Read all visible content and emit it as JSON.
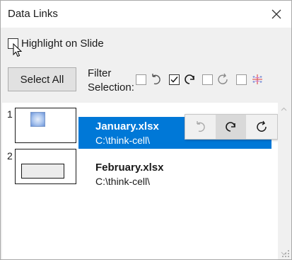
{
  "window": {
    "title": "Data Links"
  },
  "options": {
    "highlight_label": "Highlight on Slide",
    "highlight_checked": false
  },
  "toolbar": {
    "select_all_label": "Select All",
    "filter_label_line1": "Filter",
    "filter_label_line2": "Selection:"
  },
  "filters": [
    {
      "icon": "update-manual-icon",
      "checked": false
    },
    {
      "icon": "update-incoming-icon",
      "checked": true
    },
    {
      "icon": "update-auto-icon",
      "checked": false
    },
    {
      "icon": "tableau-link-icon",
      "checked": false
    }
  ],
  "rows": [
    {
      "number": "1",
      "file_name": "January.xlsx",
      "file_path": "C:\\think-cell\\",
      "selected": true
    },
    {
      "number": "2",
      "file_name": "February.xlsx",
      "file_path": "C:\\think-cell\\",
      "selected": false
    }
  ],
  "row_actions": [
    {
      "icon": "update-manual-icon",
      "state": "disabled"
    },
    {
      "icon": "update-incoming-icon",
      "state": "active"
    },
    {
      "icon": "update-auto-icon",
      "state": "normal"
    }
  ],
  "colors": {
    "selection": "#0078d7",
    "window_bg": "#f0f0f0",
    "accent_icon": "#e06060"
  }
}
